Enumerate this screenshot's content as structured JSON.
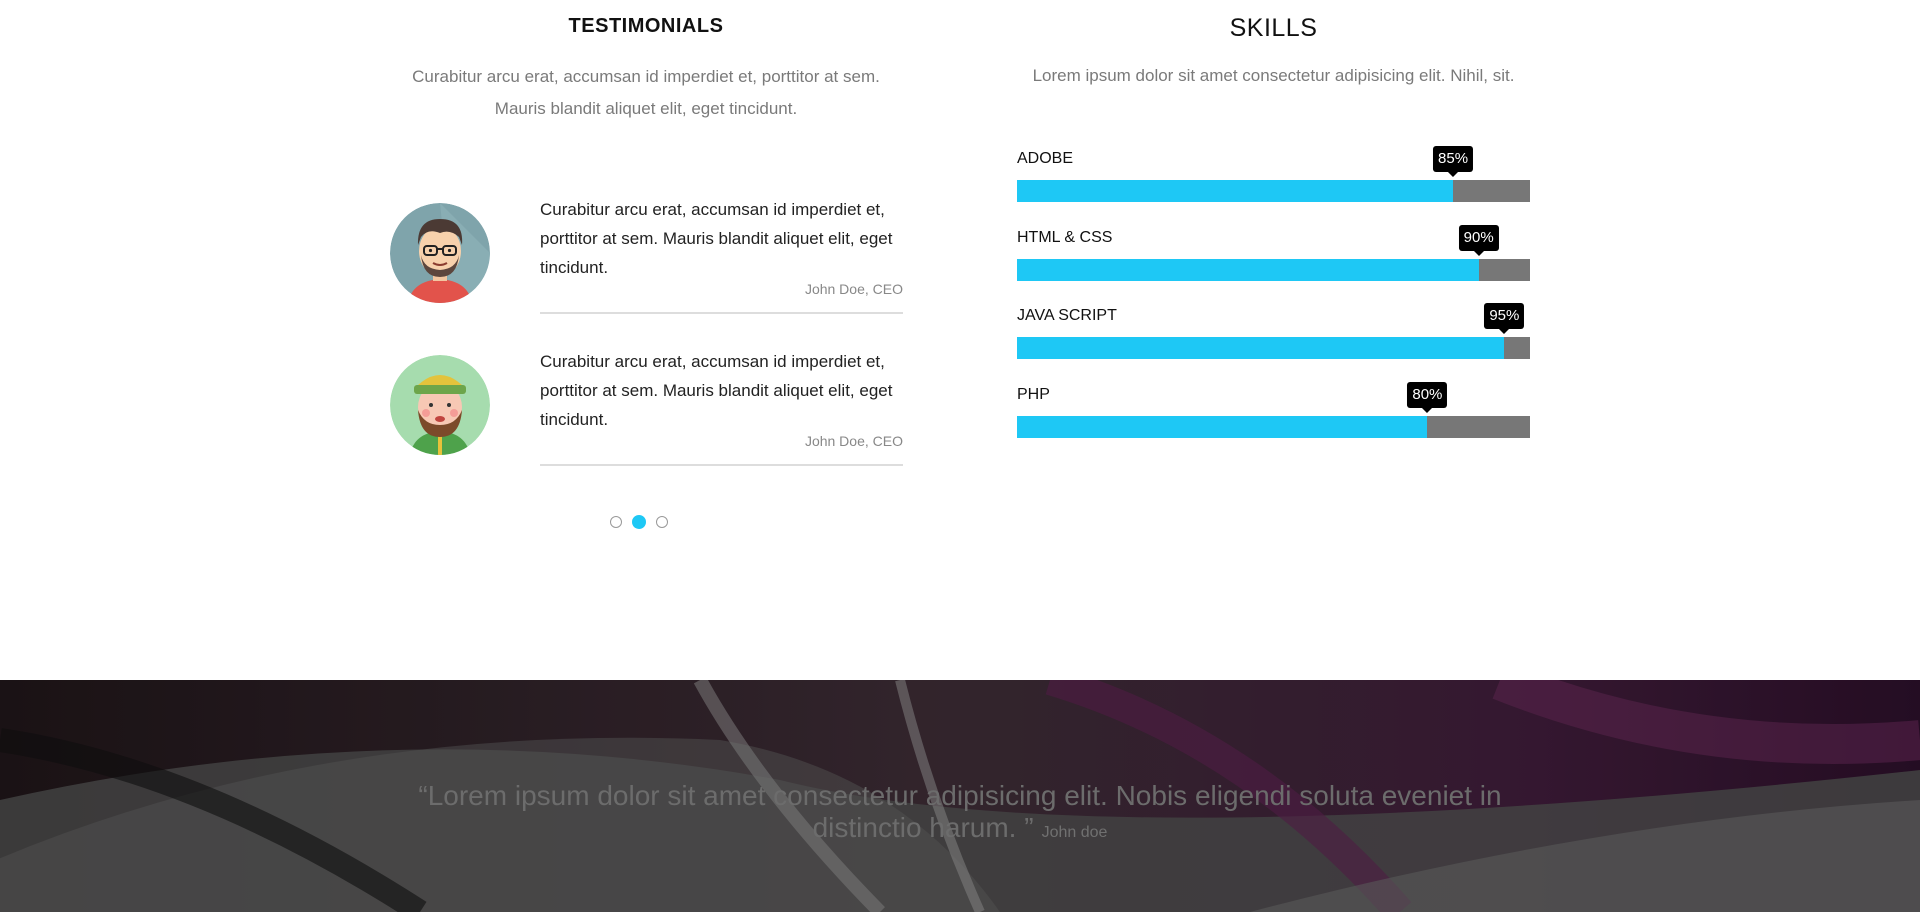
{
  "testimonials": {
    "title": "TESTIMONIALS",
    "subtitle_line1": "Curabitur arcu erat, accumsan id imperdiet et, porttitor at sem.",
    "subtitle_line2": "Mauris blandit aliquet elit, eget tincidunt.",
    "items": [
      {
        "text": "Curabitur arcu erat, accumsan id imperdiet et, porttitor at sem. Mauris blandit aliquet elit, eget tincidunt.",
        "author": "John Doe, CEO",
        "avatar": "man-glasses-avatar"
      },
      {
        "text": "Curabitur arcu erat, accumsan id imperdiet et, porttitor at sem. Mauris blandit aliquet elit, eget tincidunt.",
        "author": "John Doe, CEO",
        "avatar": "bearded-man-hat-avatar"
      }
    ],
    "pager": {
      "count": 3,
      "active": 2
    }
  },
  "skills": {
    "title": "SKILLS",
    "subtitle": "Lorem ipsum dolor sit amet consectetur adipisicing elit. Nihil, sit.",
    "items": [
      {
        "label": "ADOBE",
        "percent_label": "85%",
        "value": 85
      },
      {
        "label": "HTML & CSS",
        "percent_label": "90%",
        "value": 90
      },
      {
        "label": "JAVA SCRIPT",
        "percent_label": "95%",
        "value": 95
      },
      {
        "label": "PHP",
        "percent_label": "80%",
        "value": 80
      }
    ],
    "colors": {
      "fill": "#1ec8f5",
      "track": "#777777"
    }
  },
  "banner": {
    "quote": "“Lorem ipsum dolor sit amet consectetur adipisicing elit. Nobis eligendi soluta eveniet in distinctio harum. ”",
    "author": "John doe"
  }
}
